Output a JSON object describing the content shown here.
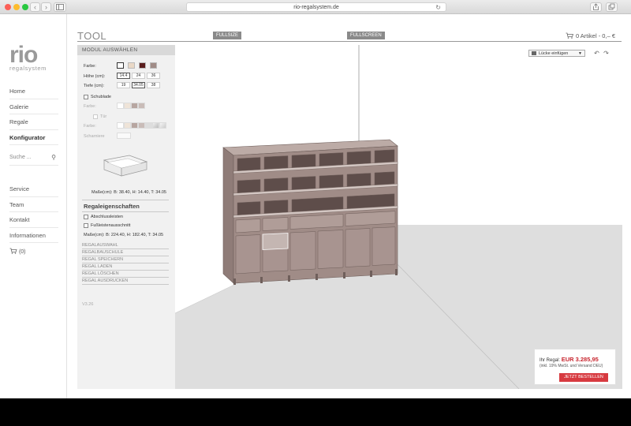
{
  "browser": {
    "url": "rio-regalsystem.de",
    "back_icon": "‹",
    "forward_icon": "›"
  },
  "brand": {
    "logo_text": "rio",
    "logo_sub": "regalsystem"
  },
  "nav": {
    "items": [
      "Home",
      "Galerie",
      "Regale",
      "Konfigurator"
    ],
    "search_placeholder": "Suche ...",
    "items2": [
      "Service",
      "Team",
      "Kontakt",
      "Informationen"
    ],
    "cart": "(0)"
  },
  "header": {
    "title": "TOOL",
    "fullsize": "FULLSIZE",
    "fullscreen": "FULLSCREEN",
    "cart": "0 Artikel - 0,– €"
  },
  "panel": {
    "heading": "MODUL AUSWÄHLEN",
    "farbe_label": "Farbe:",
    "hoehe_label": "Höhe (cm):",
    "hoehe_values": [
      "14.4",
      "24",
      "36"
    ],
    "tiefe_label": "Tiefe (cm):",
    "tiefe_values": [
      "19",
      "34.05",
      "38"
    ],
    "schublade_label": "Schublade",
    "farbe2_label": "Farbe:",
    "tuer_label": "Tür",
    "farbe3_label": "Farbe:",
    "scharniere_label": "Scharniere",
    "module_dims": "Maße(cm): B: 38.40, H: 14.40, T: 34.05",
    "props_title": "Regaleigenschaften",
    "abschluss_label": "Abschlussleisten",
    "fussleisten_label": "Fußleistenausschnitt",
    "shelf_dims": "Maße(cm): B: 224.40, H: 182.40, T: 34.05",
    "links": [
      "REGALAUSWAHL",
      "REGALBAUSCHULE",
      "REGAL SPEICHERN",
      "REGAL LADEN",
      "REGAL LÖSCHEN",
      "REGAL AUSDRUCKEN"
    ],
    "version": "V3.26"
  },
  "canvas": {
    "dropdown": "Lücke einfügen",
    "price_label": "Ihr Regal:",
    "price": "EUR 3.285,95",
    "price_note": "(inkl. 19% MwSt. und Versand DEU)",
    "order_button": "JETZT BESTELLEN"
  },
  "colors": {
    "brand_red": "#d8202f",
    "shelf_top": "#b7a6a1",
    "shelf_front": "#a08c87",
    "floor": "#dedede"
  }
}
